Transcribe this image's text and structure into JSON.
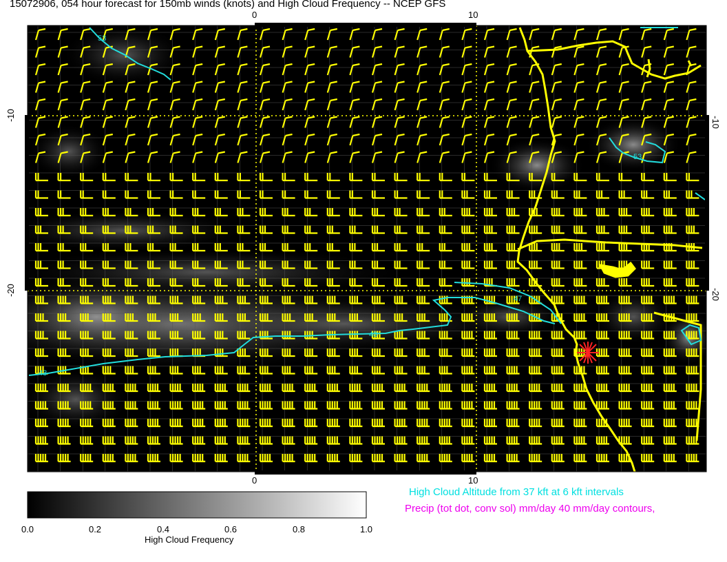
{
  "title": "15072906, 054 hour forecast for 150mb winds (knots) and High Cloud Frequency -- NCEP GFS",
  "axes": {
    "x_ticks_top": [
      "0",
      "10"
    ],
    "x_ticks_bottom": [
      "0",
      "10"
    ],
    "y_ticks_left": [
      "-10",
      "-20"
    ],
    "y_ticks_right": [
      "-10",
      "-20"
    ]
  },
  "contour_labels": [
    "53",
    "53",
    "47",
    "43",
    "43"
  ],
  "legend": {
    "cloud_altitude": "High Cloud Altitude from 37 kft at 6 kft intervals",
    "precip": "Precip (tot dot, conv sol) mm/day 40 mm/day contours,"
  },
  "colorbar": {
    "title": "High Cloud Frequency",
    "ticks": [
      "0.0",
      "0.2",
      "0.4",
      "0.6",
      "0.8",
      "1.0"
    ],
    "range": [
      0.0,
      1.0
    ]
  },
  "colors": {
    "background": "#000000",
    "wind_barbs": "#ffff00",
    "coastline": "#ffff00",
    "contours": "#22dddd",
    "marker": "#ff2222",
    "cloud_altitude_text": "#00e0e0",
    "precip_text": "#ee00ee"
  },
  "icons": {
    "station_marker": "red-asterisk-icon",
    "wind_barb": "wind-barb-icon"
  }
}
